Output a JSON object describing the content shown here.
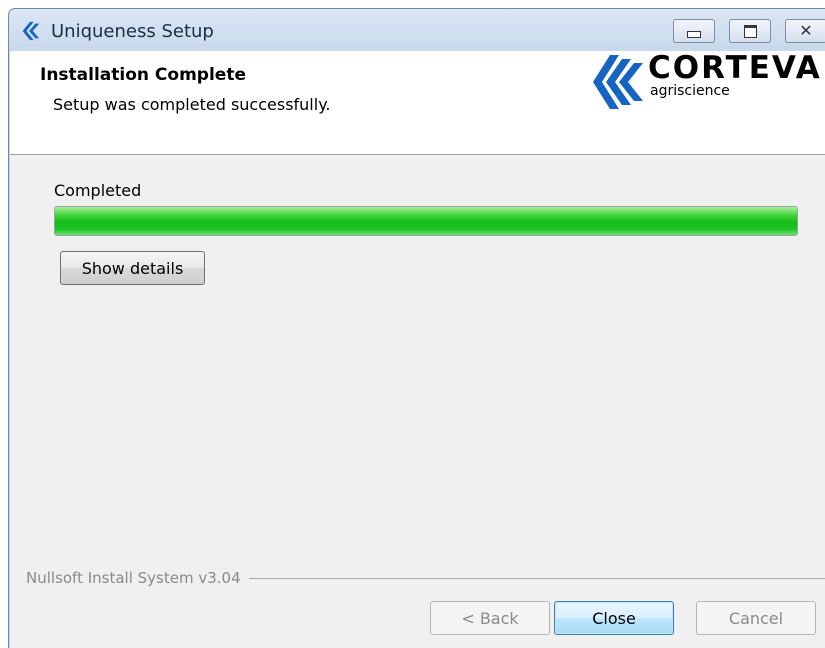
{
  "window": {
    "title": "Uniqueness Setup",
    "icon": "corteva-logo-icon",
    "controls": [
      "minimize-icon",
      "maximize-icon",
      "close-icon"
    ]
  },
  "header": {
    "title": "Installation Complete",
    "subtitle": "Setup was completed successfully.",
    "logo": {
      "word": "CORTEVA",
      "sub": "agriscience"
    }
  },
  "progress": {
    "label": "Completed",
    "value_percent": 100,
    "color": "#13bb17"
  },
  "buttons": {
    "details": "Show details",
    "back": "< Back",
    "close": "Close",
    "cancel": "Cancel"
  },
  "footer": {
    "branding": "Nullsoft Install System v3.04"
  },
  "colors": {
    "accent": "#1565c0",
    "header_bg": "#ffffff",
    "client_bg": "#f0f0f0"
  }
}
